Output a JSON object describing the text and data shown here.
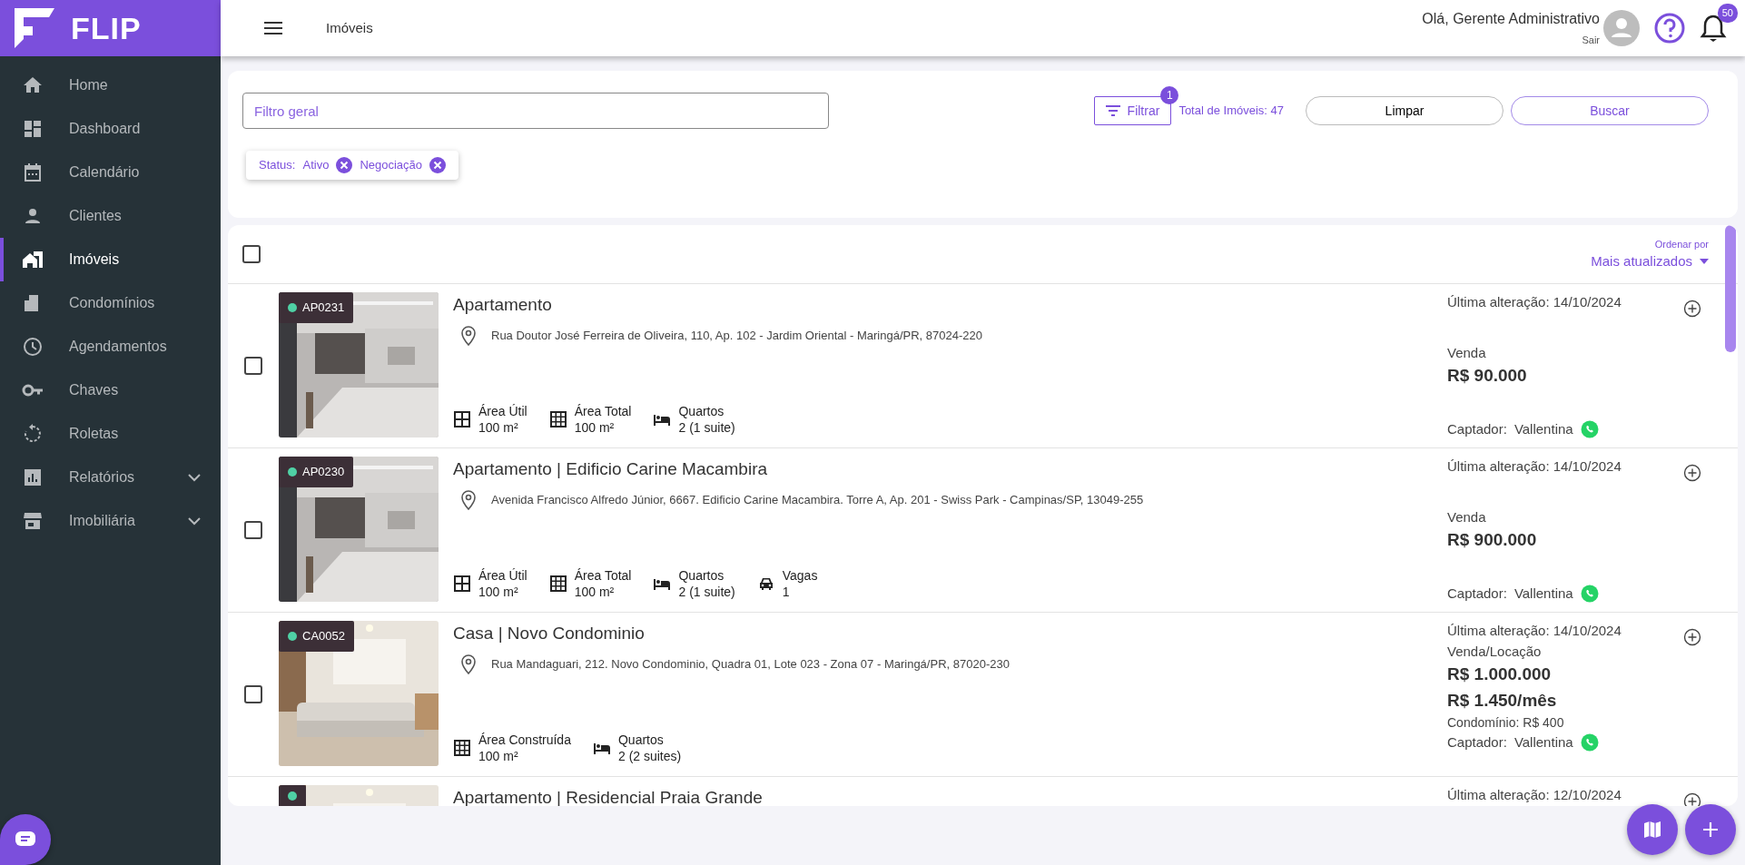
{
  "brand": {
    "name": "FLIP"
  },
  "sidebar": {
    "items": [
      {
        "label": "Home",
        "selected": false,
        "has_submenu": false
      },
      {
        "label": "Dashboard",
        "selected": false,
        "has_submenu": false
      },
      {
        "label": "Calendário",
        "selected": false,
        "has_submenu": false
      },
      {
        "label": "Clientes",
        "selected": false,
        "has_submenu": false
      },
      {
        "label": "Imóveis",
        "selected": true,
        "has_submenu": false
      },
      {
        "label": "Condomínios",
        "selected": false,
        "has_submenu": false
      },
      {
        "label": "Agendamentos",
        "selected": false,
        "has_submenu": false
      },
      {
        "label": "Chaves",
        "selected": false,
        "has_submenu": false
      },
      {
        "label": "Roletas",
        "selected": false,
        "has_submenu": false
      },
      {
        "label": "Relatórios",
        "selected": false,
        "has_submenu": true
      },
      {
        "label": "Imobiliária",
        "selected": false,
        "has_submenu": true
      }
    ]
  },
  "header": {
    "page_title": "Imóveis",
    "greeting": "Olá, Gerente Administrativo",
    "logout": "Sair",
    "notification_count": "50"
  },
  "filters": {
    "search": {
      "placeholder": "Filtro geral"
    },
    "filter_button": "Filtrar",
    "filter_count": "1",
    "total": "Total de Imóveis: 47",
    "clear_button": "Limpar",
    "search_button": "Buscar",
    "chips": [
      {
        "label": "Status:",
        "values": [
          "Ativo",
          "Negociação"
        ]
      }
    ]
  },
  "list": {
    "select_all_checked": false,
    "sort_label": "Ordenar por",
    "sort_value": "Mais atualizados",
    "properties": [
      {
        "code": "AP0231",
        "active": true,
        "checked": false,
        "title": "Apartamento",
        "address": "Rua Doutor José Ferreira de Oliveira, 110, Ap. 102 - Jardim Oriental - Maringá/PR, 87024-220",
        "features": [
          {
            "kind": "area",
            "label": "Área Útil",
            "value": "100 m²"
          },
          {
            "kind": "grid",
            "label": "Área Total",
            "value": "100 m²"
          },
          {
            "kind": "bed",
            "label": "Quartos",
            "value": "2 (1 suite)"
          }
        ],
        "updated": "Última alteração: 14/10/2024",
        "deal": "Venda",
        "prices": [
          "R$ 90.000"
        ],
        "agent_label": "Captador:",
        "agent": "Vallentina"
      },
      {
        "code": "AP0230",
        "active": true,
        "checked": false,
        "title": "Apartamento | Edificio Carine Macambira",
        "address": "Avenida Francisco Alfredo Júnior, 6667. Edificio Carine Macambira. Torre A, Ap. 201 - Swiss Park - Campinas/SP, 13049-255",
        "features": [
          {
            "kind": "area",
            "label": "Área Útil",
            "value": "100 m²"
          },
          {
            "kind": "grid",
            "label": "Área Total",
            "value": "100 m²"
          },
          {
            "kind": "bed",
            "label": "Quartos",
            "value": "2 (1 suite)"
          },
          {
            "kind": "car",
            "label": "Vagas",
            "value": "1"
          }
        ],
        "updated": "Última alteração: 14/10/2024",
        "deal": "Venda",
        "prices": [
          "R$ 900.000"
        ],
        "agent_label": "Captador:",
        "agent": "Vallentina"
      },
      {
        "code": "CA0052",
        "active": true,
        "checked": false,
        "title": "Casa | Novo Condominio",
        "address": "Rua Mandaguari, 212. Novo Condominio, Quadra 01, Lote 023 - Zona 07 - Maringá/PR, 87020-230",
        "features": [
          {
            "kind": "grid",
            "label": "Área Construída",
            "value": "100 m²"
          },
          {
            "kind": "bed",
            "label": "Quartos",
            "value": "2 (2 suites)"
          }
        ],
        "updated": "Última alteração: 14/10/2024",
        "deal": "Venda/Locação",
        "prices": [
          "R$ 1.000.000",
          "R$ 1.450/mês"
        ],
        "condo_fee": "Condomínio: R$ 400",
        "agent_label": "Captador:",
        "agent": "Vallentina"
      },
      {
        "active": true,
        "title": "Apartamento | Residencial Praia Grande",
        "updated": "Última alteração: 12/10/2024"
      }
    ]
  }
}
